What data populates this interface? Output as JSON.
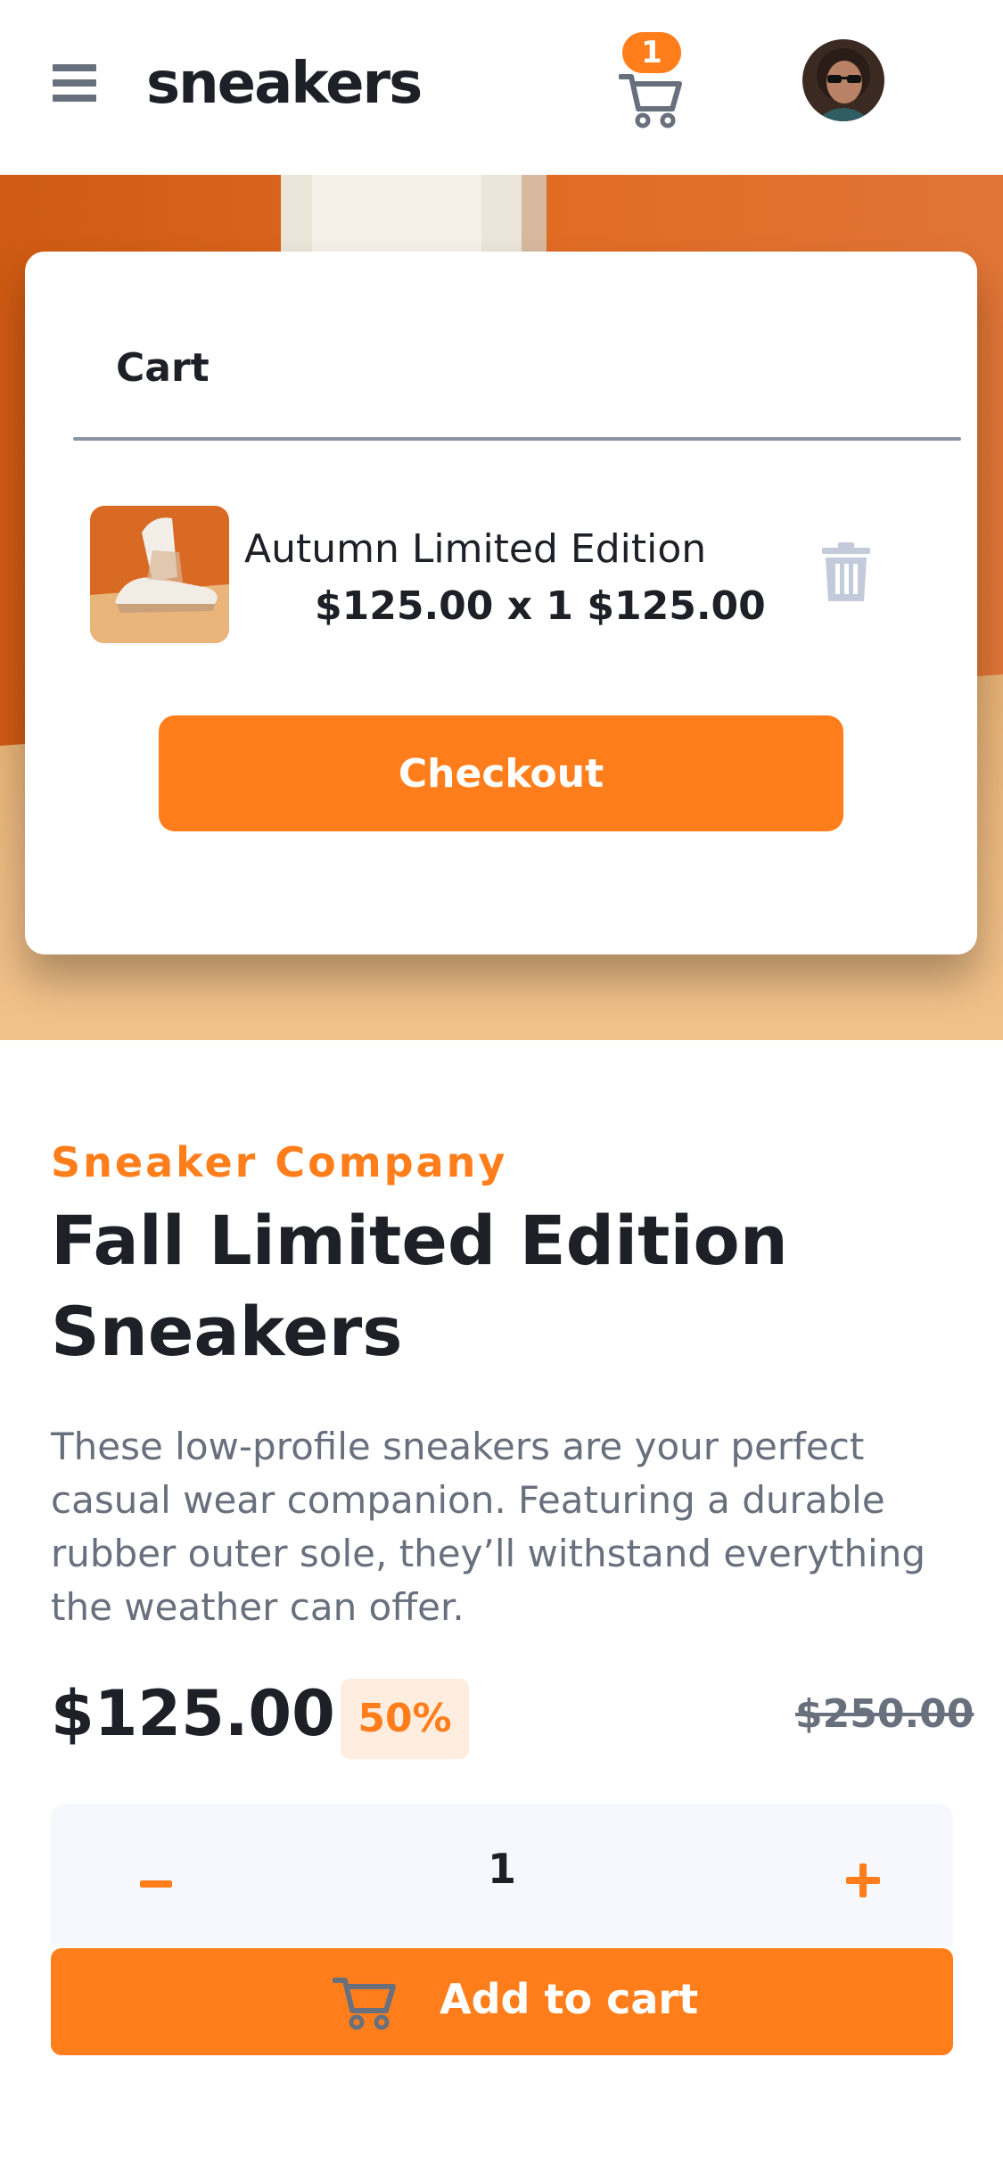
{
  "header": {
    "logo": "sneakers",
    "cart_count": "1",
    "icons": [
      "menu-icon",
      "cart-icon",
      "avatar"
    ]
  },
  "cart": {
    "title": "Cart",
    "item": {
      "name": "Autumn Limited Edition",
      "price_line": "$125.00 x 1 $125.00"
    },
    "checkout_label": "Checkout"
  },
  "product": {
    "company": "Sneaker Company",
    "title": "Fall Limited Edition Sneakers",
    "description": "These low-profile sneakers are your perfect casual wear companion. Featuring a durable rubber outer sole, they’ll withstand everything the weather can offer.",
    "price": "$125.00",
    "discount": "50%",
    "old_price": "$250.00"
  },
  "quantity": {
    "minus_label": "–",
    "value": "1",
    "plus_label": "+"
  },
  "add_to_cart_label": "Add to cart",
  "colors": {
    "accent": "#ff7e1b",
    "accent_light": "#ffede0",
    "dark": "#1d2026",
    "grey": "#69707d",
    "light_bg": "#f6f8fd"
  }
}
